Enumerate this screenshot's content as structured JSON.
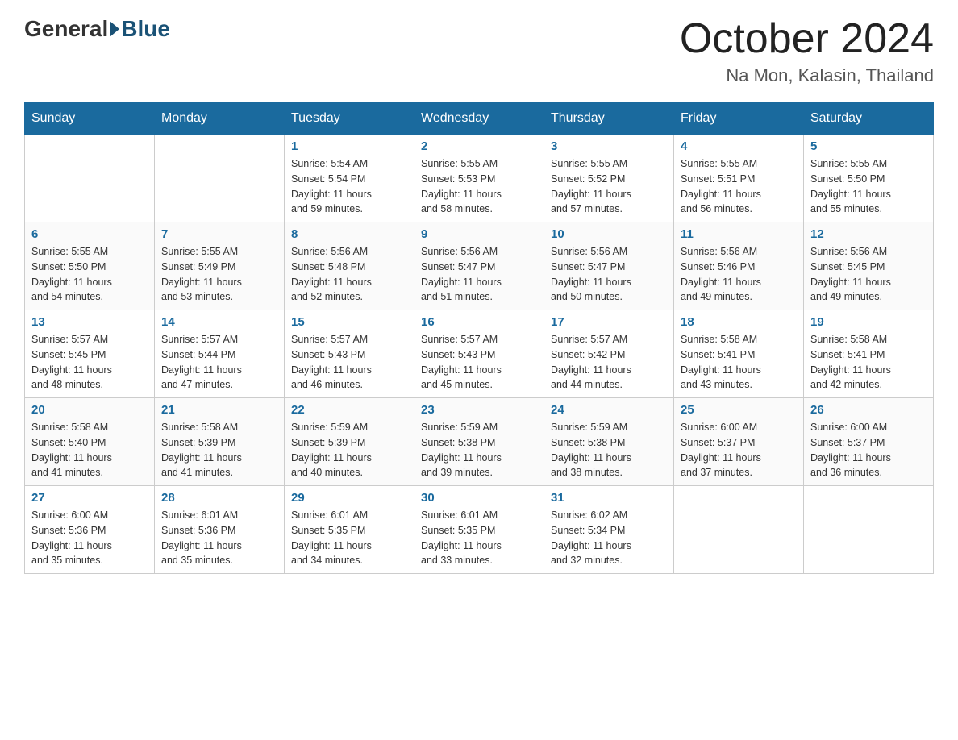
{
  "header": {
    "logo_general": "General",
    "logo_blue": "Blue",
    "title": "October 2024",
    "location": "Na Mon, Kalasin, Thailand"
  },
  "days_of_week": [
    "Sunday",
    "Monday",
    "Tuesday",
    "Wednesday",
    "Thursday",
    "Friday",
    "Saturday"
  ],
  "weeks": [
    [
      {
        "day": "",
        "info": ""
      },
      {
        "day": "",
        "info": ""
      },
      {
        "day": "1",
        "info": "Sunrise: 5:54 AM\nSunset: 5:54 PM\nDaylight: 11 hours\nand 59 minutes."
      },
      {
        "day": "2",
        "info": "Sunrise: 5:55 AM\nSunset: 5:53 PM\nDaylight: 11 hours\nand 58 minutes."
      },
      {
        "day": "3",
        "info": "Sunrise: 5:55 AM\nSunset: 5:52 PM\nDaylight: 11 hours\nand 57 minutes."
      },
      {
        "day": "4",
        "info": "Sunrise: 5:55 AM\nSunset: 5:51 PM\nDaylight: 11 hours\nand 56 minutes."
      },
      {
        "day": "5",
        "info": "Sunrise: 5:55 AM\nSunset: 5:50 PM\nDaylight: 11 hours\nand 55 minutes."
      }
    ],
    [
      {
        "day": "6",
        "info": "Sunrise: 5:55 AM\nSunset: 5:50 PM\nDaylight: 11 hours\nand 54 minutes."
      },
      {
        "day": "7",
        "info": "Sunrise: 5:55 AM\nSunset: 5:49 PM\nDaylight: 11 hours\nand 53 minutes."
      },
      {
        "day": "8",
        "info": "Sunrise: 5:56 AM\nSunset: 5:48 PM\nDaylight: 11 hours\nand 52 minutes."
      },
      {
        "day": "9",
        "info": "Sunrise: 5:56 AM\nSunset: 5:47 PM\nDaylight: 11 hours\nand 51 minutes."
      },
      {
        "day": "10",
        "info": "Sunrise: 5:56 AM\nSunset: 5:47 PM\nDaylight: 11 hours\nand 50 minutes."
      },
      {
        "day": "11",
        "info": "Sunrise: 5:56 AM\nSunset: 5:46 PM\nDaylight: 11 hours\nand 49 minutes."
      },
      {
        "day": "12",
        "info": "Sunrise: 5:56 AM\nSunset: 5:45 PM\nDaylight: 11 hours\nand 49 minutes."
      }
    ],
    [
      {
        "day": "13",
        "info": "Sunrise: 5:57 AM\nSunset: 5:45 PM\nDaylight: 11 hours\nand 48 minutes."
      },
      {
        "day": "14",
        "info": "Sunrise: 5:57 AM\nSunset: 5:44 PM\nDaylight: 11 hours\nand 47 minutes."
      },
      {
        "day": "15",
        "info": "Sunrise: 5:57 AM\nSunset: 5:43 PM\nDaylight: 11 hours\nand 46 minutes."
      },
      {
        "day": "16",
        "info": "Sunrise: 5:57 AM\nSunset: 5:43 PM\nDaylight: 11 hours\nand 45 minutes."
      },
      {
        "day": "17",
        "info": "Sunrise: 5:57 AM\nSunset: 5:42 PM\nDaylight: 11 hours\nand 44 minutes."
      },
      {
        "day": "18",
        "info": "Sunrise: 5:58 AM\nSunset: 5:41 PM\nDaylight: 11 hours\nand 43 minutes."
      },
      {
        "day": "19",
        "info": "Sunrise: 5:58 AM\nSunset: 5:41 PM\nDaylight: 11 hours\nand 42 minutes."
      }
    ],
    [
      {
        "day": "20",
        "info": "Sunrise: 5:58 AM\nSunset: 5:40 PM\nDaylight: 11 hours\nand 41 minutes."
      },
      {
        "day": "21",
        "info": "Sunrise: 5:58 AM\nSunset: 5:39 PM\nDaylight: 11 hours\nand 41 minutes."
      },
      {
        "day": "22",
        "info": "Sunrise: 5:59 AM\nSunset: 5:39 PM\nDaylight: 11 hours\nand 40 minutes."
      },
      {
        "day": "23",
        "info": "Sunrise: 5:59 AM\nSunset: 5:38 PM\nDaylight: 11 hours\nand 39 minutes."
      },
      {
        "day": "24",
        "info": "Sunrise: 5:59 AM\nSunset: 5:38 PM\nDaylight: 11 hours\nand 38 minutes."
      },
      {
        "day": "25",
        "info": "Sunrise: 6:00 AM\nSunset: 5:37 PM\nDaylight: 11 hours\nand 37 minutes."
      },
      {
        "day": "26",
        "info": "Sunrise: 6:00 AM\nSunset: 5:37 PM\nDaylight: 11 hours\nand 36 minutes."
      }
    ],
    [
      {
        "day": "27",
        "info": "Sunrise: 6:00 AM\nSunset: 5:36 PM\nDaylight: 11 hours\nand 35 minutes."
      },
      {
        "day": "28",
        "info": "Sunrise: 6:01 AM\nSunset: 5:36 PM\nDaylight: 11 hours\nand 35 minutes."
      },
      {
        "day": "29",
        "info": "Sunrise: 6:01 AM\nSunset: 5:35 PM\nDaylight: 11 hours\nand 34 minutes."
      },
      {
        "day": "30",
        "info": "Sunrise: 6:01 AM\nSunset: 5:35 PM\nDaylight: 11 hours\nand 33 minutes."
      },
      {
        "day": "31",
        "info": "Sunrise: 6:02 AM\nSunset: 5:34 PM\nDaylight: 11 hours\nand 32 minutes."
      },
      {
        "day": "",
        "info": ""
      },
      {
        "day": "",
        "info": ""
      }
    ]
  ]
}
